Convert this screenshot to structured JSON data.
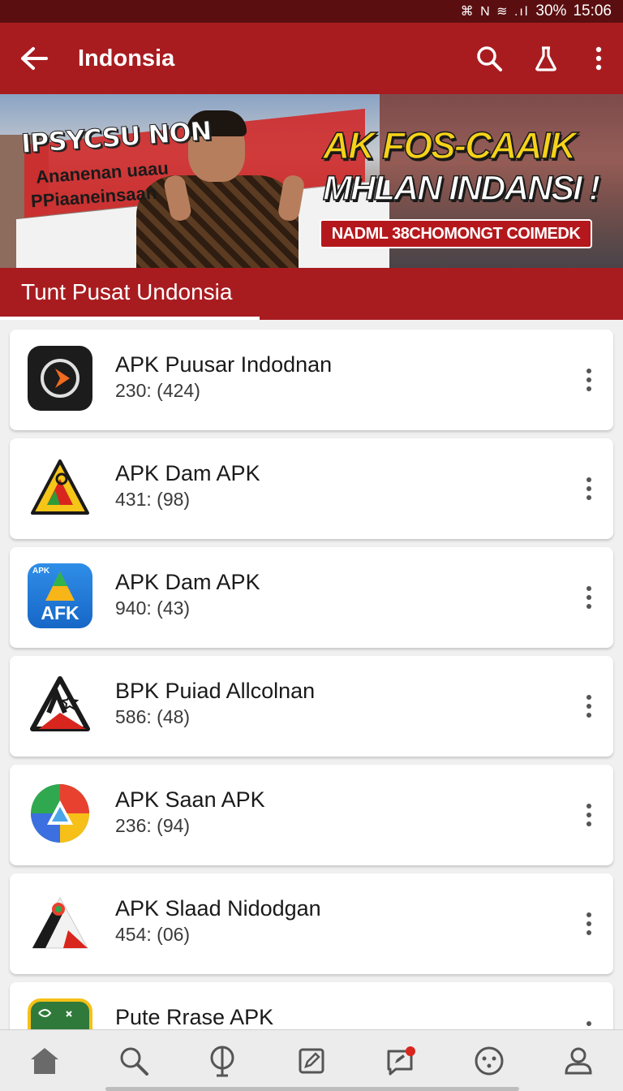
{
  "status_bar": {
    "icons": "⌘ N ≋ .ıl",
    "battery": "30%",
    "time": "15:06"
  },
  "app_bar": {
    "title": "Indonsia",
    "back_icon": "arrow-left-icon",
    "actions": [
      "search-icon",
      "flask-icon",
      "more-vert-icon"
    ]
  },
  "banner": {
    "left_title": "IPSYCSU NON",
    "left_line1": "Ananenan uaau",
    "left_line2": "PPiaaneinsaan",
    "right_title1": "AK FOS-CAAIK",
    "right_title2": "MHLAN INDANSI !",
    "cta_label": "NADML 38CHOMONGT COIMEDK"
  },
  "section_tab": {
    "label": "Tunt Pusat Undonsia"
  },
  "apps": [
    {
      "name": "APK Puusar Indodnan",
      "meta": "230: (424)"
    },
    {
      "name": "APK Dam APK",
      "meta": "431: (98)"
    },
    {
      "name": "APK Dam APK",
      "meta": "940: (43)"
    },
    {
      "name": "BPK Puiad Allcolnan",
      "meta": "586: (48)"
    },
    {
      "name": "APK Saan APK",
      "meta": "236: (94)"
    },
    {
      "name": "APK Slaad Nidodgan",
      "meta": "454: (06)"
    },
    {
      "name": "Pute Rrase APK",
      "meta": ""
    }
  ],
  "icon_labels": {
    "apk_badge_small": "APK",
    "apk_badge_big": "AFK"
  },
  "bottom_nav": [
    "home-icon",
    "search-icon",
    "globe-icon",
    "edit-icon",
    "messages-icon",
    "smiley-icon",
    "profile-icon"
  ],
  "colors": {
    "primary": "#a81c20",
    "status_bar": "#5a0e10",
    "cta": "#b4181d",
    "banner_yellow": "#f6d21a"
  }
}
